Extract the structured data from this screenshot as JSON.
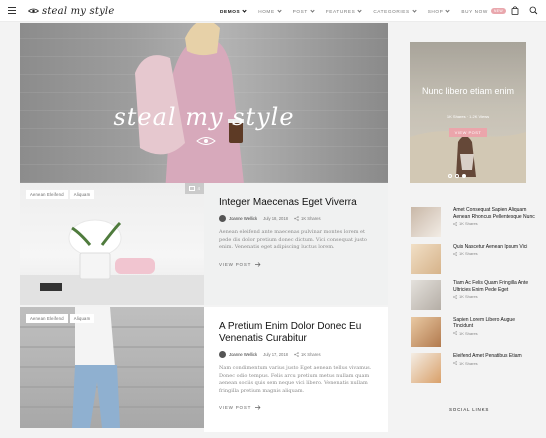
{
  "header": {
    "logo_text": "steal my style",
    "nav": [
      {
        "label": "DEMOS",
        "active": true,
        "has_chevron": true
      },
      {
        "label": "HOME",
        "active": false,
        "has_chevron": true
      },
      {
        "label": "POST",
        "active": false,
        "has_chevron": true
      },
      {
        "label": "FEATURES",
        "active": false,
        "has_chevron": true
      },
      {
        "label": "CATEGORIES",
        "active": false,
        "has_chevron": true
      },
      {
        "label": "SHOP",
        "active": false,
        "has_chevron": true
      },
      {
        "label": "BUY NOW",
        "active": false,
        "has_chevron": false,
        "badge": "NEW"
      }
    ],
    "icons": [
      "menu-icon",
      "cart-icon",
      "search-icon"
    ]
  },
  "hero": {
    "logo_text": "steal my style"
  },
  "posts": [
    {
      "tags": [
        "Aenean Eleifend",
        "Aliquam"
      ],
      "gallery_count": "4",
      "title": "Integer Maecenas Eget Viverra",
      "author": "Joanne Wellick",
      "date": "July 18, 2018",
      "shares": "1K Shares",
      "excerpt": "Aenean eleifend ante maecenas pulvinar montes lorem et pede dis dolor pretium donec dictum. Vici consequat justo enim. Venenatis eget adipiscing luctus lorem.",
      "cta": "VIEW POST"
    },
    {
      "tags": [
        "Aenean Eleifend",
        "Aliquam"
      ],
      "title": "A Pretium Enim Dolor Donec Eu Venenatis Curabitur",
      "author": "Joanne Wellick",
      "date": "July 17, 2018",
      "shares": "1K Shares",
      "excerpt": "Nam condimentum varius justo Eget aenean tellus vivamus. Donec odio tempus. Felis arcu pretium metus nullam quam aenean sociis quis sem neque vici libero. Venenatis nullam fringilla pretium magnis aliquam.",
      "cta": "VIEW POST"
    }
  ],
  "promo": {
    "title": "Nunc libero etiam enim",
    "shares": "1K Shares   ·   1.2K Views",
    "button": "VIEW POST"
  },
  "sidebar_posts": [
    {
      "title": "Amet Consequat Sapien Aliquam Aenean Rhoncus Pellentesque Nunc",
      "shares": "1K Shares"
    },
    {
      "title": "Quis Nascetur Aenean Ipsum Vici",
      "shares": "1K Shares"
    },
    {
      "title": "Tiam Ac Felis Quam Fringilla Ante Ultricies Enim Pede Eget",
      "shares": "1K Shares"
    },
    {
      "title": "Sapien Lorem Libero Augue Tincidunt",
      "shares": "1K Shares"
    },
    {
      "title": "Eleifend Amet Penatibus Etiam",
      "shares": "1K Shares"
    }
  ],
  "social_heading": "SOCIAL LINKS",
  "colors": {
    "accent": "#eba5ab",
    "text": "#111111",
    "muted": "#888888"
  }
}
